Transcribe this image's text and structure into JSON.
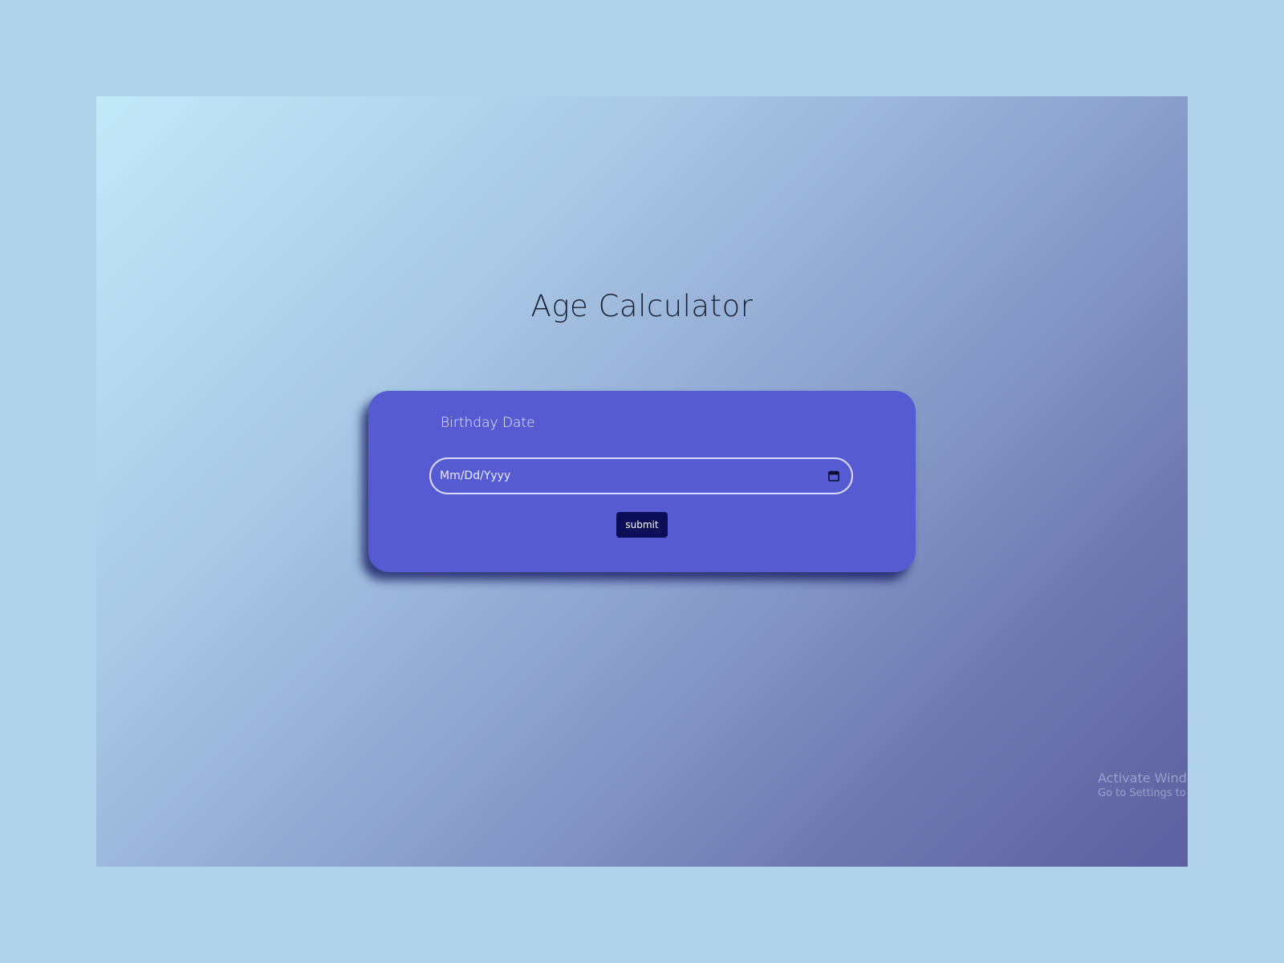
{
  "page": {
    "title": "Age Calculator"
  },
  "form": {
    "label": "Birthday Date",
    "date_placeholder": "Mm/Dd/Yyyy",
    "submit_label": "submit",
    "calendar_icon": "calendar-icon"
  },
  "watermark": {
    "line1": "Activate Windows",
    "line2": "Go to Settings to activate Windows."
  },
  "colors": {
    "card": "#575bd1",
    "button": "#0b0e56"
  }
}
